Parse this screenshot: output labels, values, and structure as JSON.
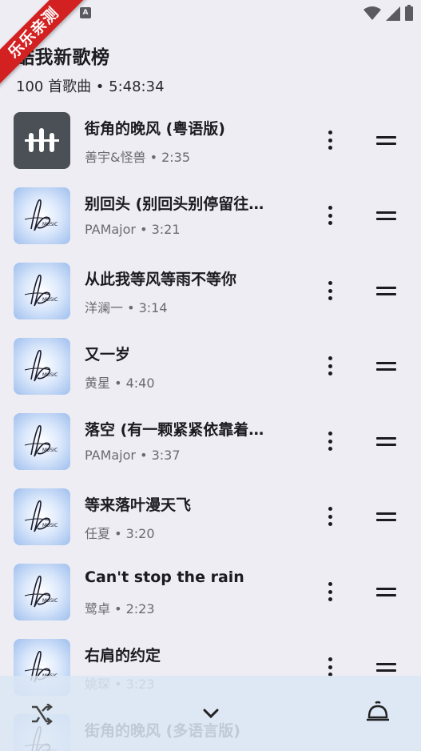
{
  "status_bar": {
    "left_badge": "A"
  },
  "watermark": {
    "text": "乐乐亲测"
  },
  "playlist": {
    "title": "酷我新歌榜",
    "subtitle": "100 首歌曲 • 5:48:34"
  },
  "songs": [
    {
      "title": "街角的晚风 (粤语版)",
      "meta": "善宇&怪兽 • 2:35",
      "playing": true
    },
    {
      "title": "别回头 (别回头别停留往…",
      "meta": "PAMajor • 3:21"
    },
    {
      "title": "从此我等风等雨不等你",
      "meta": "洋澜一 • 3:14"
    },
    {
      "title": "又一岁",
      "meta": "黄星 • 4:40"
    },
    {
      "title": "落空 (有一颗紧紧依靠着…",
      "meta": "PAMajor • 3:37"
    },
    {
      "title": "等来落叶漫天飞",
      "meta": "任夏 • 3:20"
    },
    {
      "title": "Can't stop the rain",
      "meta": "鹭卓 • 2:23"
    },
    {
      "title": "右肩的约定",
      "meta": "姚琛 • 3:23"
    },
    {
      "title": "街角的晚风 (多语言版)",
      "meta": ""
    }
  ],
  "cover_text": "MUSIC",
  "bottom_bar": {
    "shuffle_icon": "shuffle-icon",
    "collapse_icon": "chevron-down-icon",
    "queue_icon": "queue-bell-icon"
  },
  "colors": {
    "background": "#eeedf3",
    "bottom_bar": "#dbe7f4",
    "watermark": "#d32020"
  }
}
